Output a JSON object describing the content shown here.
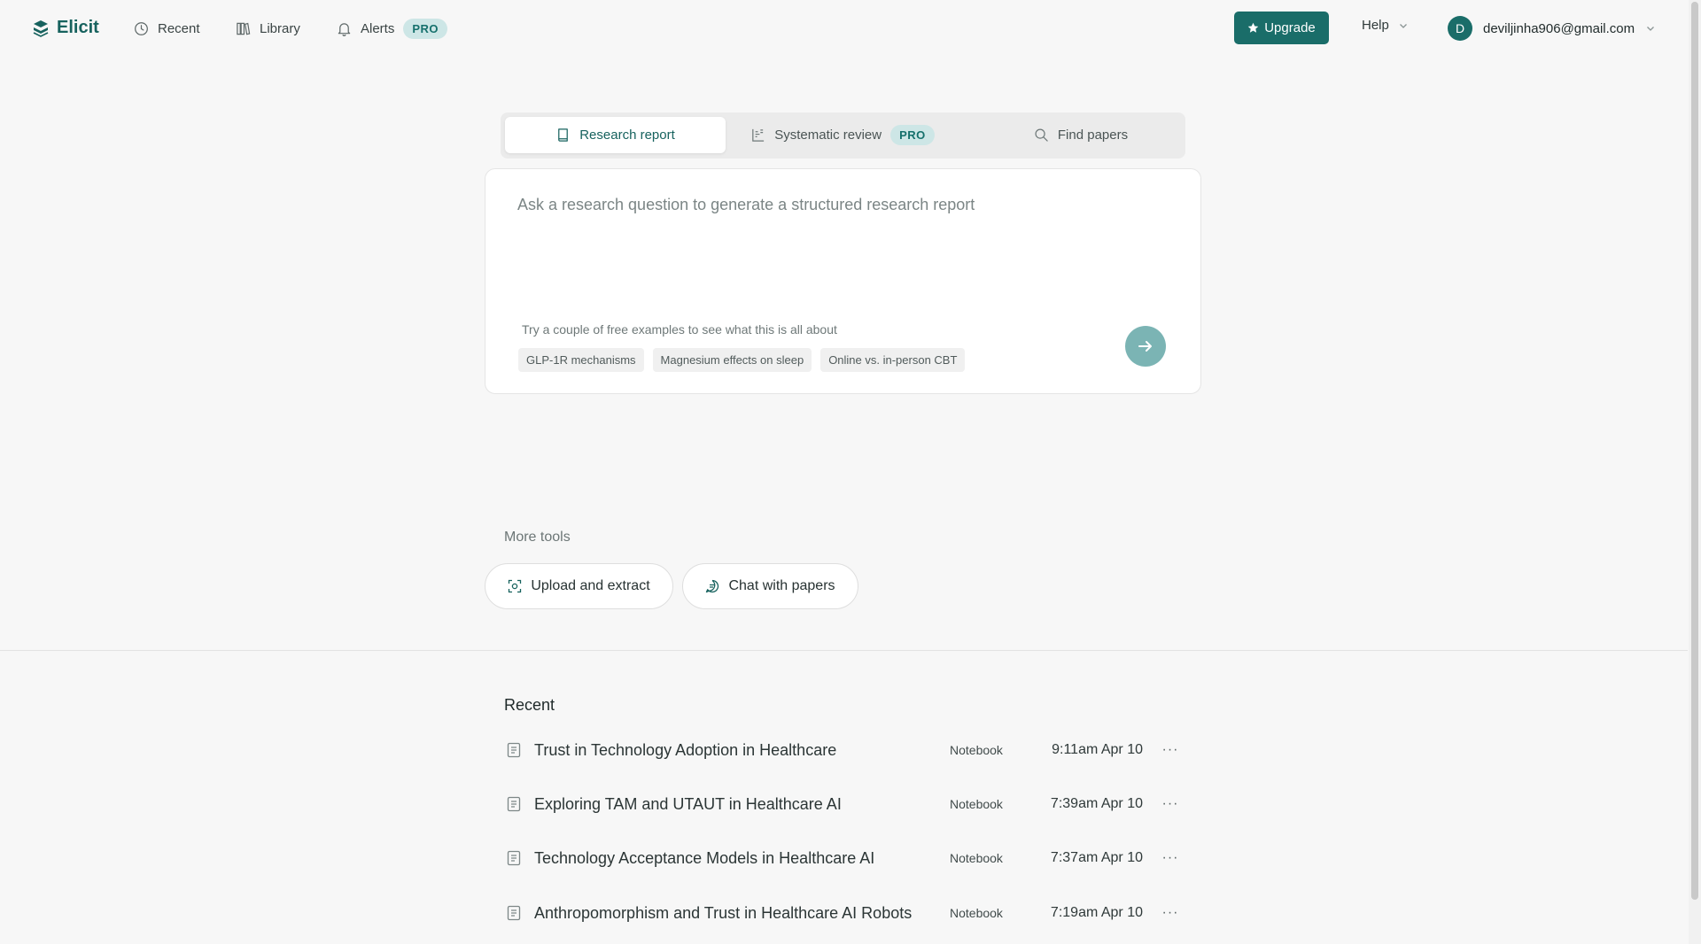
{
  "brand": {
    "name": "Elicit",
    "color": "#17625e"
  },
  "nav": {
    "recent": "Recent",
    "library": "Library",
    "alerts": "Alerts",
    "alerts_badge": "PRO",
    "upgrade": "Upgrade",
    "help": "Help",
    "avatar_initial": "D",
    "account_email": "deviljinha906@gmail.com"
  },
  "modes": {
    "research_report": "Research report",
    "systematic_review": "Systematic review",
    "systematic_review_badge": "PRO",
    "find_papers": "Find papers"
  },
  "query": {
    "placeholder": "Ask a research question to generate a structured research report",
    "examples_hint": "Try a couple of free examples to see what this is all about",
    "examples": [
      "GLP-1R mechanisms",
      "Magnesium effects on sleep",
      "Online vs. in-person CBT"
    ]
  },
  "more_tools": {
    "label": "More tools",
    "upload": "Upload and extract",
    "chat": "Chat with papers"
  },
  "recent": {
    "title": "Recent",
    "items": [
      {
        "title": "Trust in Technology Adoption in Healthcare",
        "type": "Notebook",
        "time": "9:11am Apr 10"
      },
      {
        "title": "Exploring TAM and UTAUT in Healthcare AI",
        "type": "Notebook",
        "time": "7:39am Apr 10"
      },
      {
        "title": "Technology Acceptance Models in Healthcare AI",
        "type": "Notebook",
        "time": "7:37am Apr 10"
      },
      {
        "title": "Anthropomorphism and Trust in Healthcare AI Robots",
        "type": "Notebook",
        "time": "7:19am Apr 10"
      }
    ],
    "more_icon_glyph": "···"
  },
  "icons": {
    "logo": "elicit-logo-icon",
    "recent": "clock-icon",
    "library": "library-icon",
    "alerts": "bell-icon",
    "upgrade": "star-icon",
    "research_report": "book-icon",
    "systematic_review": "list-icon",
    "find_papers": "search-icon",
    "submit": "arrow-right-icon",
    "upload": "scan-icon",
    "chat": "chat-icon",
    "recent_item": "document-icon"
  }
}
